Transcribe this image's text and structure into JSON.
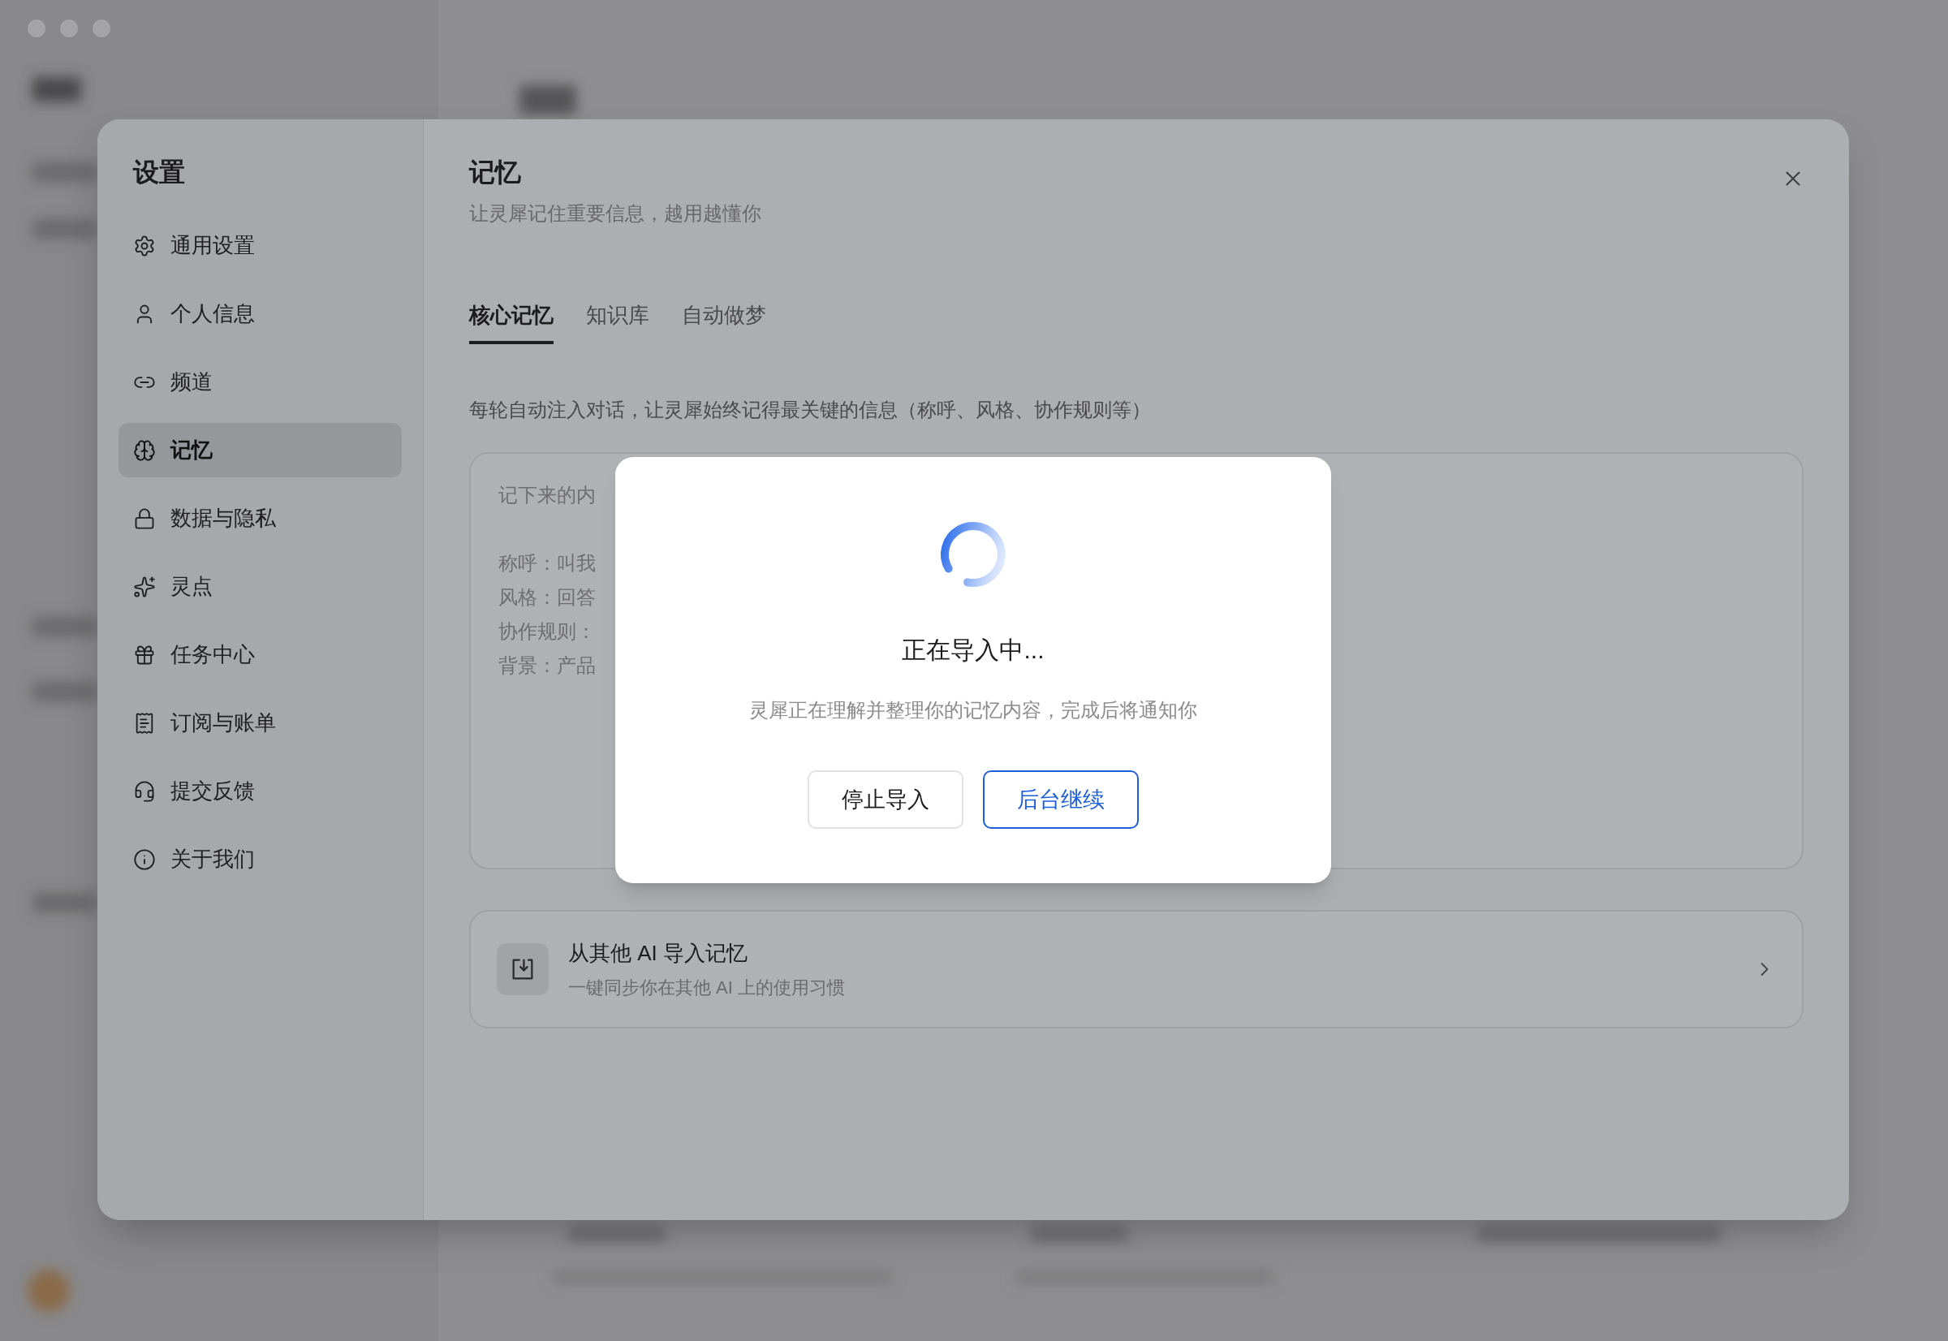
{
  "settings": {
    "title": "设置",
    "nav": [
      {
        "label": "通用设置",
        "selected": false
      },
      {
        "label": "个人信息",
        "selected": false
      },
      {
        "label": "频道",
        "selected": false
      },
      {
        "label": "记忆",
        "selected": true
      },
      {
        "label": "数据与隐私",
        "selected": false
      },
      {
        "label": "灵点",
        "selected": false
      },
      {
        "label": "任务中心",
        "selected": false
      },
      {
        "label": "订阅与账单",
        "selected": false
      },
      {
        "label": "提交反馈",
        "selected": false
      },
      {
        "label": "关于我们",
        "selected": false
      }
    ]
  },
  "page": {
    "title": "记忆",
    "subtitle": "让灵犀记住重要信息，越用越懂你",
    "tabs": [
      {
        "label": "核心记忆",
        "selected": true
      },
      {
        "label": "知识库",
        "selected": false
      },
      {
        "label": "自动做梦",
        "selected": false
      }
    ],
    "description": "每轮自动注入对话，让灵犀始终记得最关键的信息（称呼、风格、协作规则等）",
    "memory_text": {
      "lines": [
        "记下来的内",
        "称呼：叫我",
        "风格：回答",
        "协作规则：",
        "背景：产品"
      ]
    },
    "import_card": {
      "title": "从其他 AI 导入记忆",
      "subtitle": "一键同步你在其他 AI 上的使用习惯"
    }
  },
  "dialog": {
    "title": "正在导入中...",
    "message": "灵犀正在理解并整理你的记忆内容，完成后将通知你",
    "buttons": [
      {
        "label": "停止导入",
        "kind": "secondary"
      },
      {
        "label": "后台继续",
        "kind": "primary"
      }
    ]
  }
}
